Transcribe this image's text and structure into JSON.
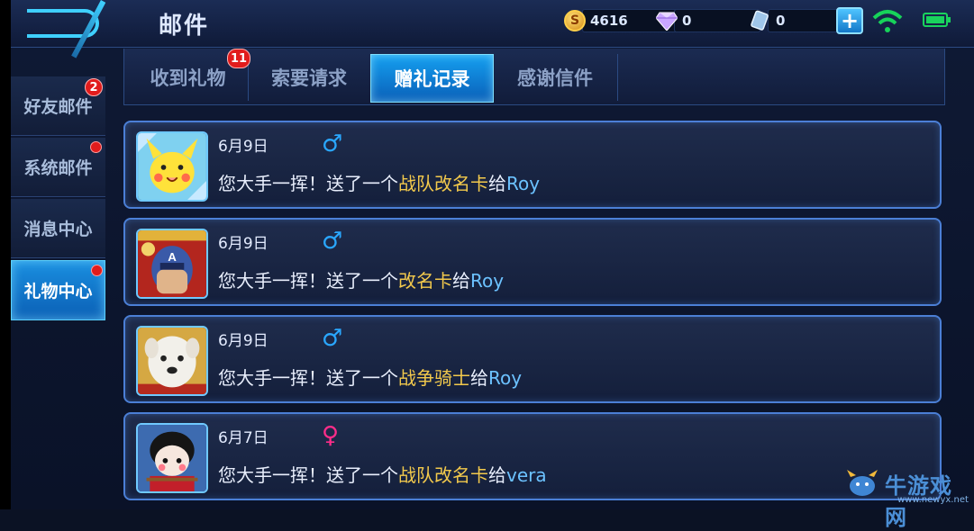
{
  "header": {
    "title": "邮件",
    "coins": "4616",
    "diamonds": "0",
    "tickets": "0",
    "coin_symbol": "S",
    "plus_symbol": "+"
  },
  "sidebar": {
    "items": [
      {
        "label": "好友邮件",
        "badge": "2",
        "active": false
      },
      {
        "label": "系统邮件",
        "dot": true,
        "active": false
      },
      {
        "label": "消息中心",
        "active": false
      },
      {
        "label": "礼物中心",
        "dot": true,
        "active": true
      }
    ]
  },
  "tabs": [
    {
      "label": "收到礼物",
      "badge": "11",
      "active": false
    },
    {
      "label": "索要请求",
      "active": false
    },
    {
      "label": "赠礼记录",
      "active": true
    },
    {
      "label": "感谢信件",
      "active": false
    }
  ],
  "records": [
    {
      "date": "6月9日",
      "gender": "male",
      "gender_symbol": "♂",
      "prefix": "您大手一挥！送了一个",
      "item": "战队改名卡",
      "mid": "给",
      "name": "Roy",
      "avatar": "pikachu-avatar"
    },
    {
      "date": "6月9日",
      "gender": "male",
      "gender_symbol": "♂",
      "prefix": "您大手一挥！送了一个",
      "item": "改名卡",
      "mid": "给",
      "name": "Roy",
      "avatar": "captain-avatar"
    },
    {
      "date": "6月9日",
      "gender": "male",
      "gender_symbol": "♂",
      "prefix": "您大手一挥！送了一个",
      "item": "战争骑士",
      "mid": "给",
      "name": "Roy",
      "avatar": "dog-avatar"
    },
    {
      "date": "6月7日",
      "gender": "female",
      "gender_symbol": "♀",
      "prefix": "您大手一挥！送了一个",
      "item": "战队改名卡",
      "mid": "给",
      "name": "vera",
      "avatar": "doll-avatar"
    }
  ],
  "watermark": {
    "text": "牛游戏网",
    "url": "www.newyx.net"
  },
  "colors": {
    "accent": "#15a0f0",
    "item": "#f2c94c",
    "name": "#6cc2ff",
    "male": "#2aa7ff",
    "female": "#ff2d8a",
    "badge": "#e11c1c"
  }
}
